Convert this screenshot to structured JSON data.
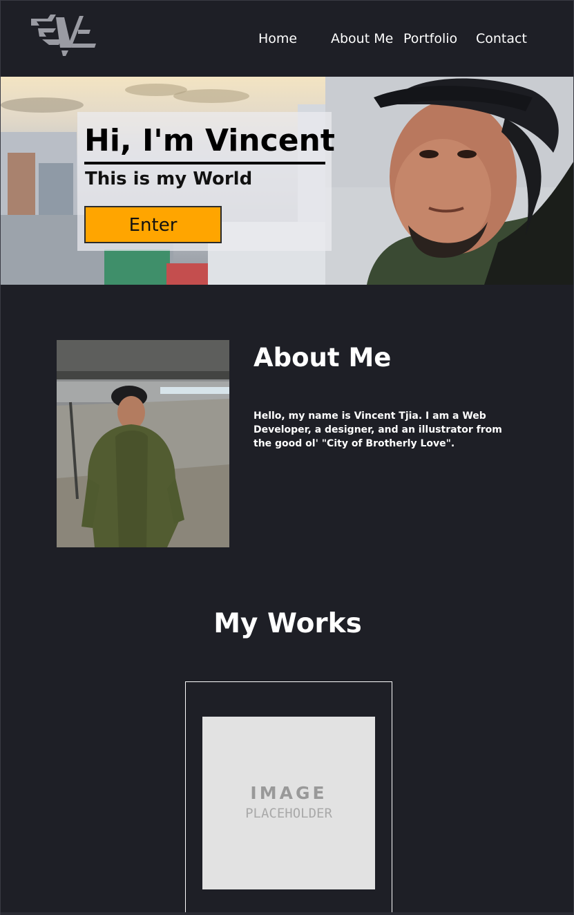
{
  "nav": {
    "home": "Home",
    "about": "About Me",
    "portfolio": "Portfolio",
    "contact": "Contact"
  },
  "hero": {
    "title": "Hi, I'm Vincent",
    "subtitle": "This is my World",
    "button_label": "Enter",
    "button_color": "#ffa500"
  },
  "about": {
    "title": "About Me",
    "text": "Hello, my name is Vincent Tjia. I am a Web Developer, a designer, and an illustrator from the good ol' \"City of Brotherly Love\"."
  },
  "works": {
    "title": "My Works",
    "items": [
      {
        "placeholder_line1": "IMAGE",
        "placeholder_line2": "PLACEHOLDER"
      }
    ]
  },
  "colors": {
    "background": "#1e1f26",
    "text": "#ffffff",
    "accent": "#ffa500"
  },
  "icons": {
    "logo": "v-logo-icon"
  }
}
